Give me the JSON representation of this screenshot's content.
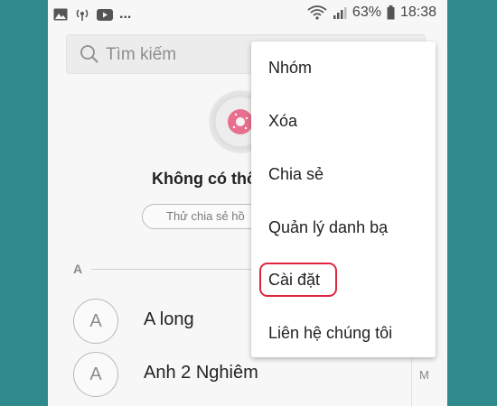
{
  "status_bar": {
    "dots": "...",
    "battery_percent": "63%",
    "time": "18:38",
    "icons": [
      "image-icon",
      "broadcast-icon",
      "youtube-icon",
      "wifi-icon",
      "signal-icon",
      "battery-icon"
    ]
  },
  "search": {
    "placeholder": "Tìm kiếm"
  },
  "empty_state": {
    "message": "Không có thô",
    "share_hint": "Thử chia sẻ hồ"
  },
  "contacts": {
    "section": "A",
    "items": [
      {
        "initial": "A",
        "name": "A long"
      },
      {
        "initial": "A",
        "name": "Anh 2 Nghiêm"
      }
    ],
    "index_letter": "M"
  },
  "menu": {
    "items": [
      "Nhóm",
      "Xóa",
      "Chia sẻ",
      "Quản lý danh bạ",
      "Cài đặt",
      "Liên hệ chúng tôi"
    ],
    "highlighted_index": 4,
    "highlight_color": "#e0263f"
  }
}
